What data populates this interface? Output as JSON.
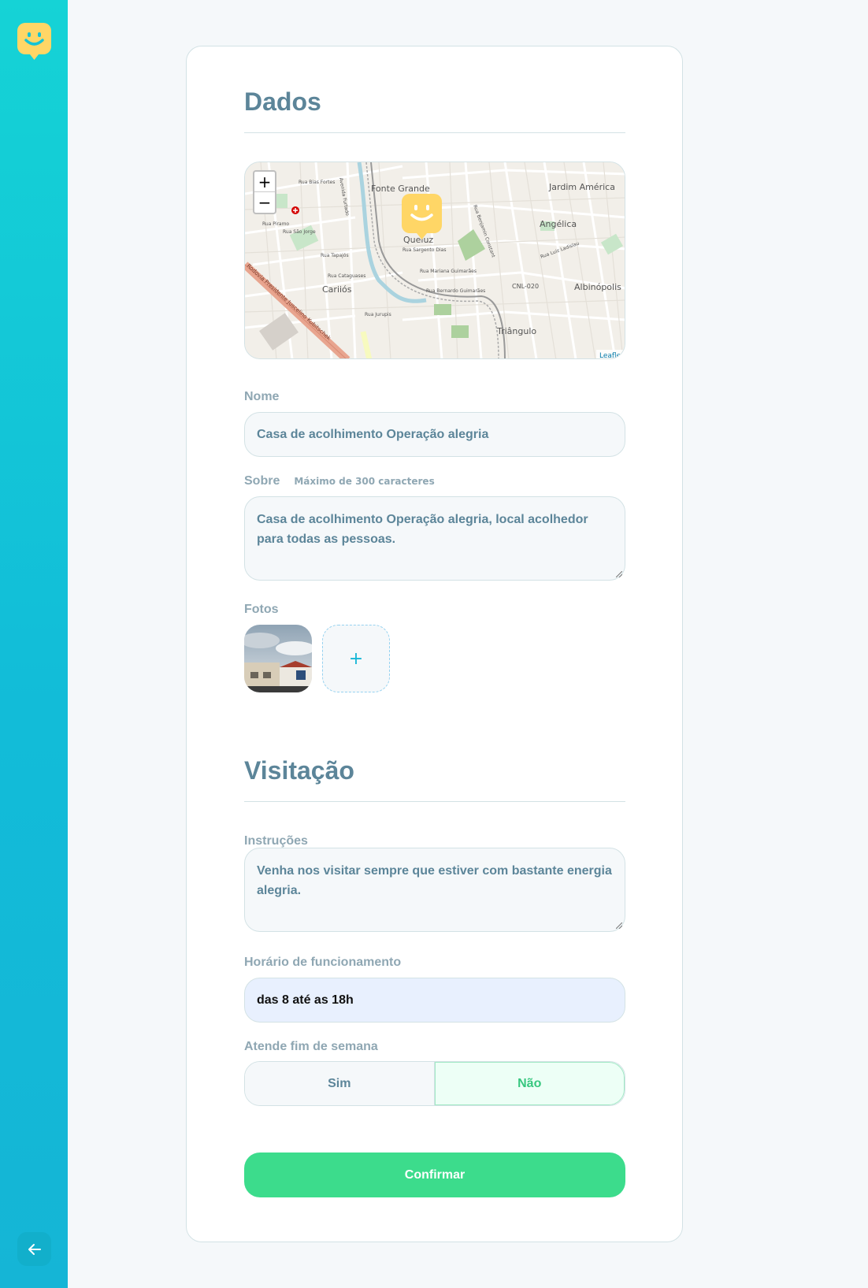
{
  "sidebar": {
    "logo_icon": "happy-face-pin-icon",
    "back_icon": "arrow-left-icon",
    "accent": "#15c3d6"
  },
  "dados": {
    "title": "Dados",
    "map": {
      "zoom_in": "+",
      "zoom_out": "−",
      "attribution": "Leaflet",
      "labels": [
        "Fonte Grande",
        "Jardim América",
        "Angélica",
        "Queluz",
        "Cariiós",
        "Albinópolis",
        "Triângulo",
        "CNL-020",
        "Rua Mariana Guimarães",
        "Rua Bernardo Guimarães",
        "Rua Tapajós",
        "Rua Cataguases",
        "Rua São Jorge",
        "Rua Piramo",
        "Rua Bias Fortes",
        "Avenida Furtado",
        "Rua Sargento Dias",
        "Rua Benjamin Constant",
        "Rua Luiz Ladislau",
        "Rua Jurupis",
        "Rodovia Presidente Juscelino Kubitschek"
      ]
    },
    "nome": {
      "label": "Nome",
      "value": "Casa de acolhimento Operação alegria"
    },
    "sobre": {
      "label": "Sobre",
      "hint": "Máximo de 300 caracteres",
      "value": "Casa de acolhimento Operação alegria, local acolhedor para todas as pessoas."
    },
    "fotos": {
      "label": "Fotos",
      "add_label": "+"
    }
  },
  "visitacao": {
    "title": "Visitação",
    "instrucoes": {
      "label": "Instruções",
      "value": "Venha nos visitar sempre que estiver com bastante energia alegria."
    },
    "horario": {
      "label": "Horário de funcionamento",
      "value": "das 8 até as 18h"
    },
    "fim_de_semana": {
      "label": "Atende fim de semana",
      "sim": "Sim",
      "nao": "Não",
      "selected": "Não"
    }
  },
  "confirm_label": "Confirmar",
  "colors": {
    "title": "#5c8599",
    "confirm": "#3cdc8c",
    "selected_green": "#37c77f",
    "marker": "#ffd666"
  }
}
